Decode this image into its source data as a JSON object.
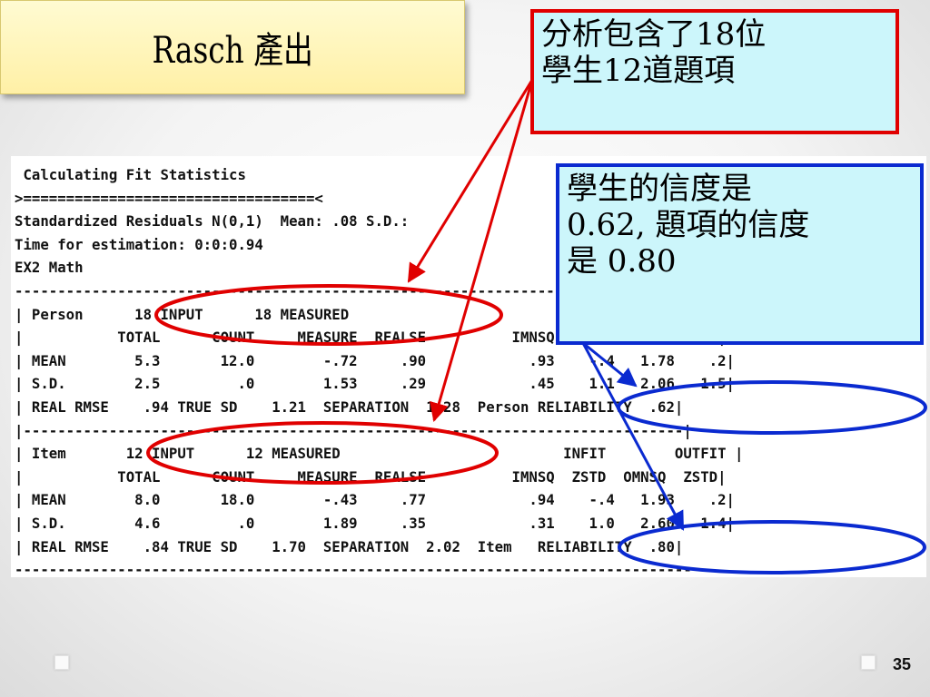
{
  "slide": {
    "title": "Rasch 產出",
    "page_number": "35"
  },
  "output_lines": [
    " Calculating Fit Statistics",
    ">==================================<",
    "Standardized Residuals N(0,1)  Mean: .08 S.D.:",
    "Time for estimation: 0:0:0.94",
    "EX2 Math",
    "-------------------------------------------------------------------------------",
    "| Person      18 INPUT      18 MEASURED                          INFIT        OUTFIT |",
    "|           TOTAL      COUNT     MEASURE  REALSE          IMNSQ  ZSTD  OMNSQ  ZSTD|",
    "| MEAN        5.3       12.0        -.72     .90            .93    -.4   1.78    .2|",
    "| S.D.        2.5         .0        1.53     .29            .45    1.1   2.06   1.5|",
    "| REAL RMSE    .94 TRUE SD    1.21  SEPARATION  1.28  Person RELIABILITY  .62|",
    "|-----------------------------------------------------------------------------|",
    "| Item       12 INPUT      12 MEASURED                          INFIT        OUTFIT |",
    "|           TOTAL      COUNT     MEASURE  REALSE          IMNSQ  ZSTD  OMNSQ  ZSTD|",
    "| MEAN        8.0       18.0        -.43     .77            .94    -.4   1.93    .2|",
    "| S.D.        4.6         .0        1.89     .35            .31    1.0   2.60   1.4|",
    "| REAL RMSE    .84 TRUE SD    1.70  SEPARATION  2.02  Item   RELIABILITY  .80|",
    "-------------------------------------------------------------------------------"
  ],
  "callouts": {
    "sample": {
      "lines": [
        "分析包含了18位",
        "學生12道題項"
      ],
      "border_color": "#e00000"
    },
    "reliability": {
      "lines": [
        "學生的信度是",
        "0.62, 題項的信度",
        "是 0.80"
      ],
      "border_color": "#0a2ad0"
    }
  },
  "colors": {
    "title_background": "#fff3b0",
    "callout_background": "#ccf6fb",
    "red_annotation": "#e00000",
    "blue_annotation": "#0a2ad0"
  }
}
